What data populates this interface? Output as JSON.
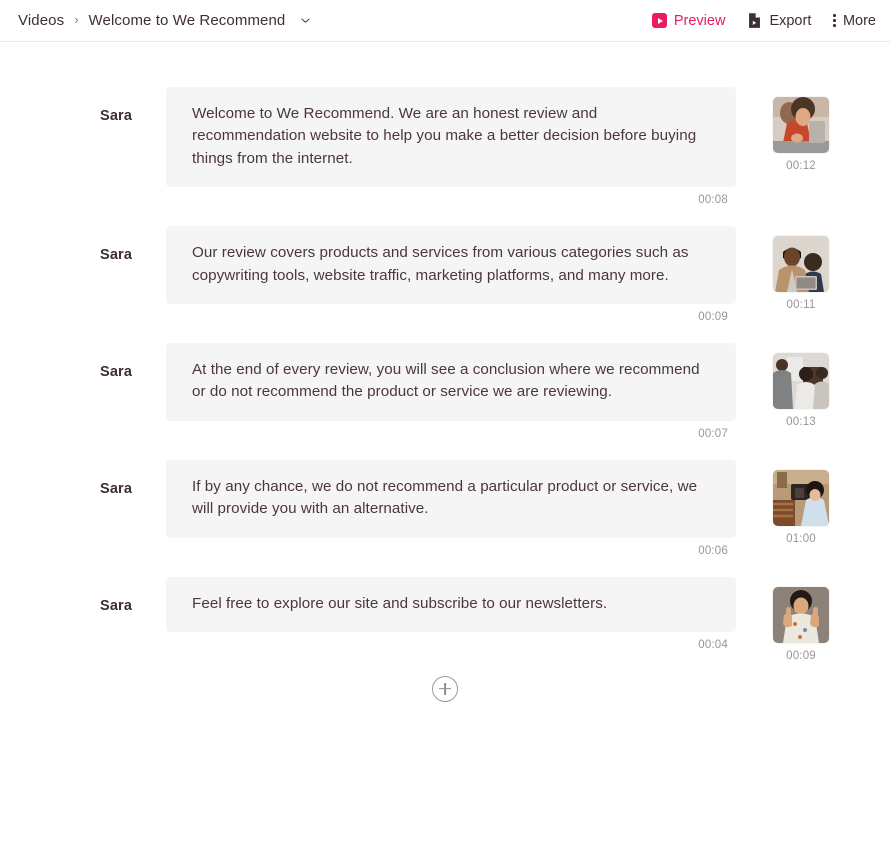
{
  "header": {
    "breadcrumb": {
      "root": "Videos",
      "separator": "›",
      "current": "Welcome to We Recommend",
      "caret_icon": "chevron-down-icon"
    },
    "actions": [
      {
        "label": "Preview",
        "icon": "play-badge-icon",
        "color": "#ea1a63"
      },
      {
        "label": "Export",
        "icon": "document-export-icon",
        "color": "#3f2e34"
      },
      {
        "label": "More",
        "icon": "vertical-dots-icon",
        "color": "#3f2e34"
      }
    ]
  },
  "script": {
    "rows": [
      {
        "speaker": "Sara",
        "text": "Welcome to We Recommend. We are an honest review and recommendation website to help you make a better decision before buying things from the internet.",
        "bubble_duration": "00:08",
        "media_duration": "00:12",
        "thumbnail": "woman-in-red-top-at-desk"
      },
      {
        "speaker": "Sara",
        "text": "Our review covers products and services from various categories such as copywriting tools, website traffic, marketing platforms, and many more.",
        "bubble_duration": "00:09",
        "media_duration": "00:11",
        "thumbnail": "man-in-beige-blazer-with-laptop"
      },
      {
        "speaker": "Sara",
        "text": "At the end of every review, you will see a conclusion where we recommend or do not recommend the product or service we are reviewing.",
        "bubble_duration": "00:07",
        "media_duration": "00:13",
        "thumbnail": "people-standing-in-office"
      },
      {
        "speaker": "Sara",
        "text": "If by any chance, we do not recommend a particular product or service, we will provide you with an alternative.",
        "bubble_duration": "00:06",
        "media_duration": "01:00",
        "thumbnail": "woman-shopping-for-bags"
      },
      {
        "speaker": "Sara",
        "text": "Feel free to explore our site and subscribe to our newsletters.",
        "bubble_duration": "00:04",
        "media_duration": "00:09",
        "thumbnail": "man-giving-two-thumbs-up"
      }
    ],
    "add_scene_icon": "plus-circle-icon"
  }
}
